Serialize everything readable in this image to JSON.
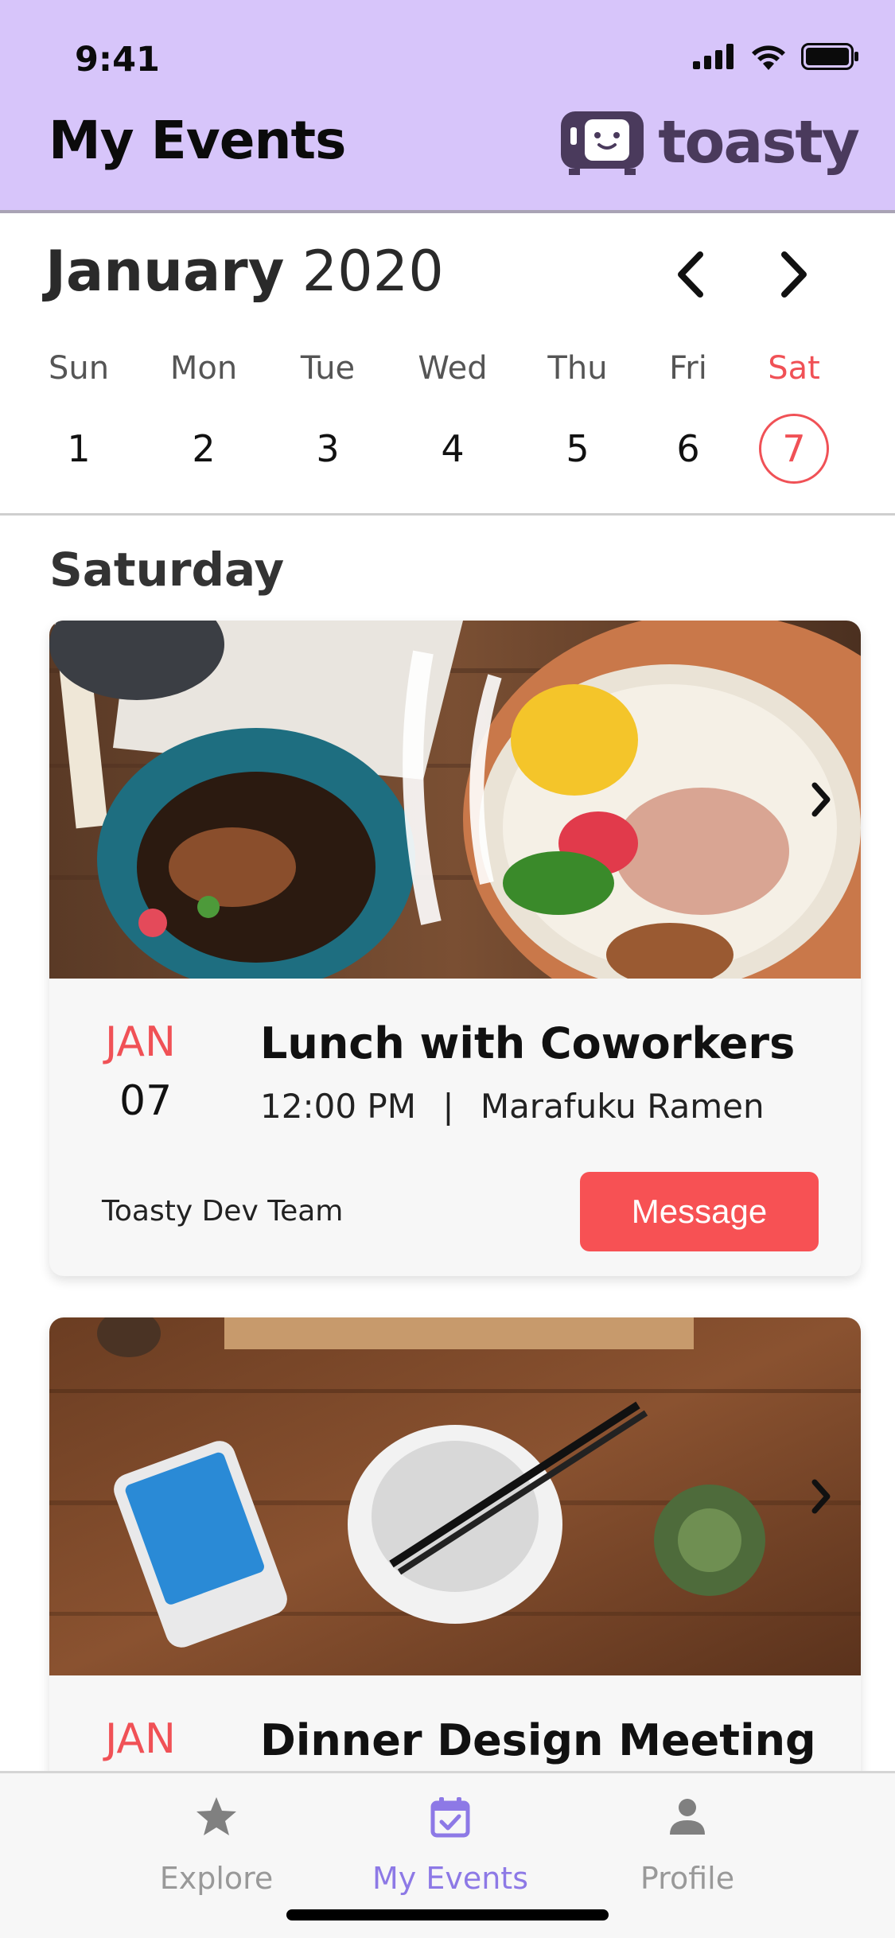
{
  "status_bar": {
    "time": "9:41"
  },
  "header": {
    "title": "My Events",
    "logo_text": "toasty"
  },
  "calendar": {
    "month": "January",
    "year": "2020",
    "days": [
      {
        "name": "Sun",
        "num": "1"
      },
      {
        "name": "Mon",
        "num": "2"
      },
      {
        "name": "Tue",
        "num": "3"
      },
      {
        "name": "Wed",
        "num": "4"
      },
      {
        "name": "Thu",
        "num": "5"
      },
      {
        "name": "Fri",
        "num": "6"
      },
      {
        "name": "Sat",
        "num": "7",
        "selected": true
      }
    ]
  },
  "section": {
    "title": "Saturday"
  },
  "events": [
    {
      "month": "JAN",
      "day": "07",
      "title": "Lunch with Coworkers",
      "time": "12:00 PM",
      "separator": "|",
      "location": "Marafuku Ramen",
      "organizer": "Toasty Dev Team",
      "button": "Message",
      "image_icon": "ramen-bowl-photo"
    },
    {
      "month": "JAN",
      "title": "Dinner Design Meeting",
      "image_icon": "empty-bowl-chopsticks-photo"
    }
  ],
  "tabs": [
    {
      "label": "Explore",
      "icon": "star-icon"
    },
    {
      "label": "My Events",
      "icon": "calendar-check-icon",
      "active": true
    },
    {
      "label": "Profile",
      "icon": "person-icon"
    }
  ],
  "colors": {
    "header_bg": "#d7c5fa",
    "accent": "#f05156",
    "button": "#f75154",
    "active_tab": "#8d79e6",
    "logo": "#4a3a5c"
  }
}
